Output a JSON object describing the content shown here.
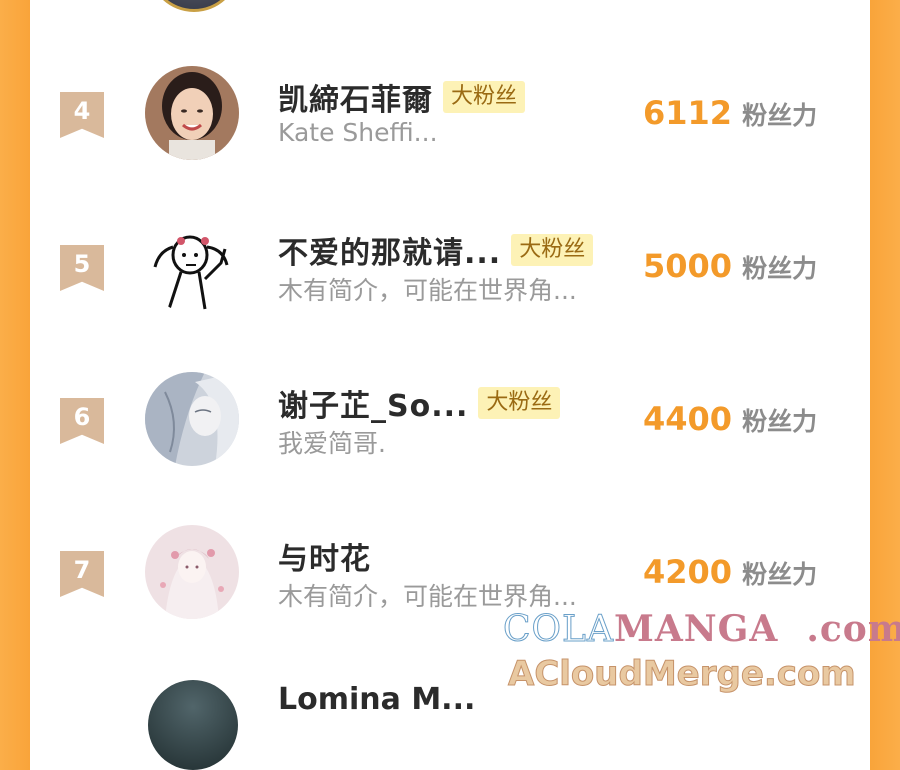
{
  "rows": [
    {
      "rank": "4",
      "name": "凯締石菲爾",
      "tag": "大粉丝",
      "bio": "Kate Sheffi...",
      "score": "6112",
      "unit": "粉丝力"
    },
    {
      "rank": "5",
      "name": "不爱的那就请...",
      "tag": "大粉丝",
      "bio": "木有简介，可能在世界角...",
      "score": "5000",
      "unit": "粉丝力"
    },
    {
      "rank": "6",
      "name": "谢子芷_So...",
      "tag": "大粉丝",
      "bio": "我爱简哥.",
      "score": "4400",
      "unit": "粉丝力"
    },
    {
      "rank": "7",
      "name": "与时花",
      "tag": "",
      "bio": "木有简介，可能在世界角...",
      "score": "4200",
      "unit": "粉丝力"
    }
  ],
  "partial_next": {
    "name": "Lomina M..."
  },
  "watermark": {
    "part1": "COLA",
    "part2": "MANGA",
    "part3": ".com",
    "line2": "ACloudMerge.com"
  },
  "colors": {
    "accent_orange": "#f39a2a",
    "side_orange": "#f9a43a",
    "tag_bg": "#fdf2b6",
    "rank_badge": "#d9b99b"
  }
}
